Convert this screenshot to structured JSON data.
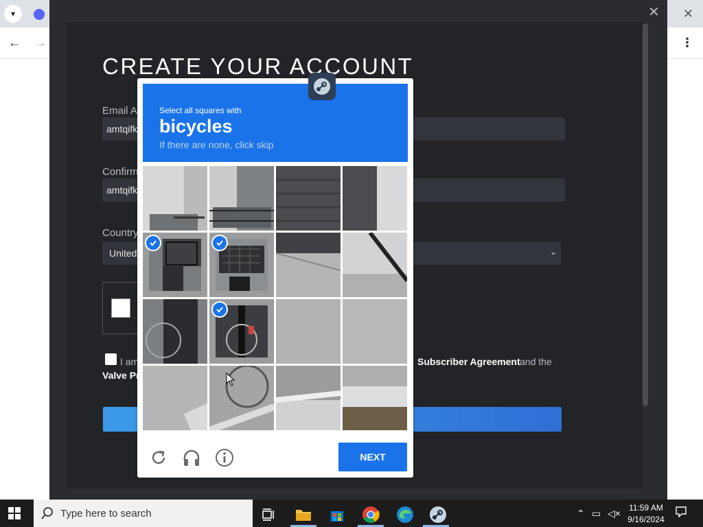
{
  "browser": {
    "tab_dropdown_icon": "chevron-down-icon",
    "tab_favicon": "discord-icon",
    "close_glyph": "✕",
    "back_glyph": "←",
    "forward_glyph": "→",
    "menu_glyph": "⋮"
  },
  "steam_modal": {
    "close_glyph": "✕",
    "title": "CREATE YOUR ACCOUNT",
    "email_label": "Email Ac",
    "email_value": "amtqifk",
    "confirm_label": "Confirm",
    "confirm_value": "amtqifk",
    "country_label": "Country",
    "country_value": "United",
    "select_arrow": "⌄",
    "agree_text": "I am",
    "agree_link": "Subscriber Agreement",
    "agree_rest": "and the",
    "agree_line2": "Valve Pr"
  },
  "captcha": {
    "prompt_prefix": "Select all squares with",
    "prompt_word": "bicycles",
    "prompt_hint": "If there are none, click skip",
    "selected_tiles": [
      4,
      5,
      9
    ],
    "refresh_icon": "refresh-icon",
    "audio_icon": "headphones-icon",
    "info_icon": "info-icon",
    "next_label": "NEXT",
    "accent": "#1a73e8"
  },
  "taskbar": {
    "search_placeholder": "Type here to search",
    "time": "11:59 AM",
    "date": "9/16/2024",
    "apps": [
      "task-view-icon",
      "file-explorer-icon",
      "microsoft-store-icon",
      "chrome-icon",
      "edge-icon",
      "steam-icon"
    ]
  }
}
